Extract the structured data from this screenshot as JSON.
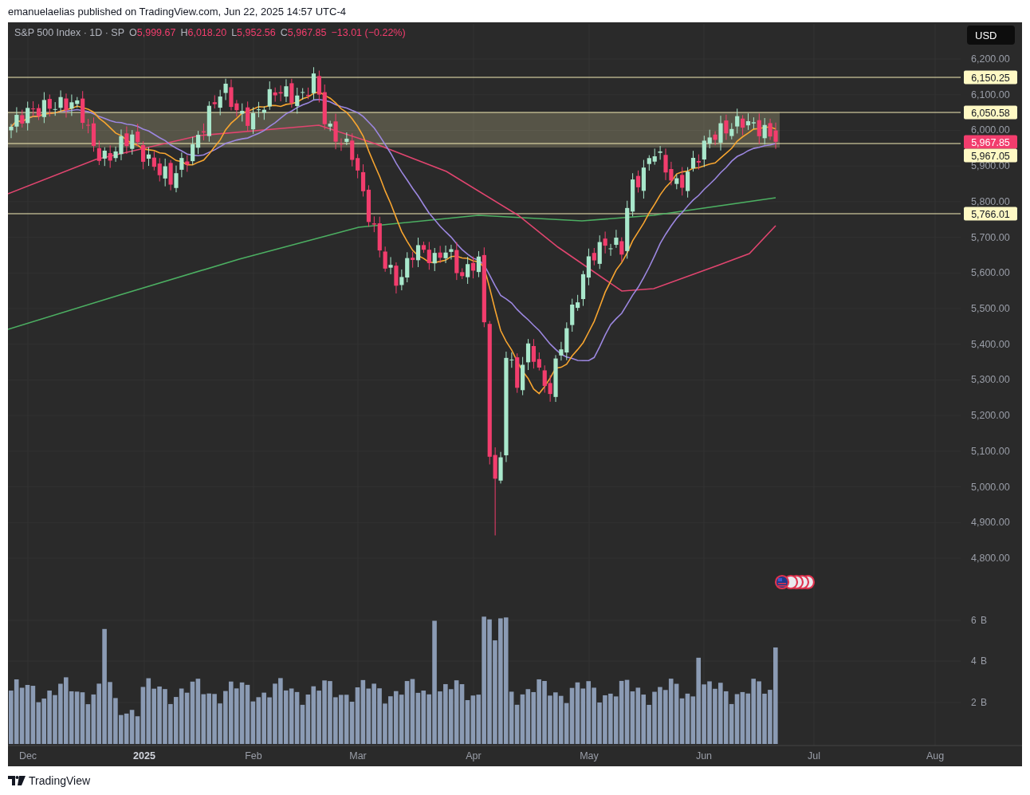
{
  "publish_line": "emanuelaelias published on TradingView.com, Jun 22, 2025 14:57 UTC-4",
  "legend": {
    "symbol": "S&P 500 Index · 1D · SP",
    "fields": [
      {
        "label": "O",
        "value": "5,999.67"
      },
      {
        "label": "H",
        "value": "6,018.20"
      },
      {
        "label": "L",
        "value": "5,952.56"
      },
      {
        "label": "C",
        "value": "5,967.85"
      }
    ],
    "change": "−13.01 (−0.22%)"
  },
  "currency": "USD",
  "price_ticks": [
    "6,200.00",
    "6,100.00",
    "6,000.00",
    "5,900.00",
    "5,800.00",
    "5,700.00",
    "5,600.00",
    "5,500.00",
    "5,400.00",
    "5,300.00",
    "5,200.00",
    "5,100.00",
    "5,000.00",
    "4,900.00",
    "4,800.00"
  ],
  "level_labels": [
    {
      "text": "6,150.25",
      "kind": "level"
    },
    {
      "text": "6,050.58",
      "kind": "level"
    },
    {
      "text": "5,967.85",
      "kind": "last"
    },
    {
      "text": "5,967.05",
      "kind": "level"
    },
    {
      "text": "5,766.01",
      "kind": "level"
    }
  ],
  "volume_ticks": [
    "6 B",
    "4 B",
    "2 B"
  ],
  "time_ticks": [
    {
      "label": "Dec",
      "bold": false
    },
    {
      "label": "2025",
      "bold": true
    },
    {
      "label": "Feb",
      "bold": false
    },
    {
      "label": "Mar",
      "bold": false
    },
    {
      "label": "Apr",
      "bold": false
    },
    {
      "label": "May",
      "bold": false
    },
    {
      "label": "Jun",
      "bold": false
    },
    {
      "label": "Jul",
      "bold": false
    },
    {
      "label": "Aug",
      "bold": false
    }
  ],
  "footer": {
    "brand": "TradingView"
  }
}
